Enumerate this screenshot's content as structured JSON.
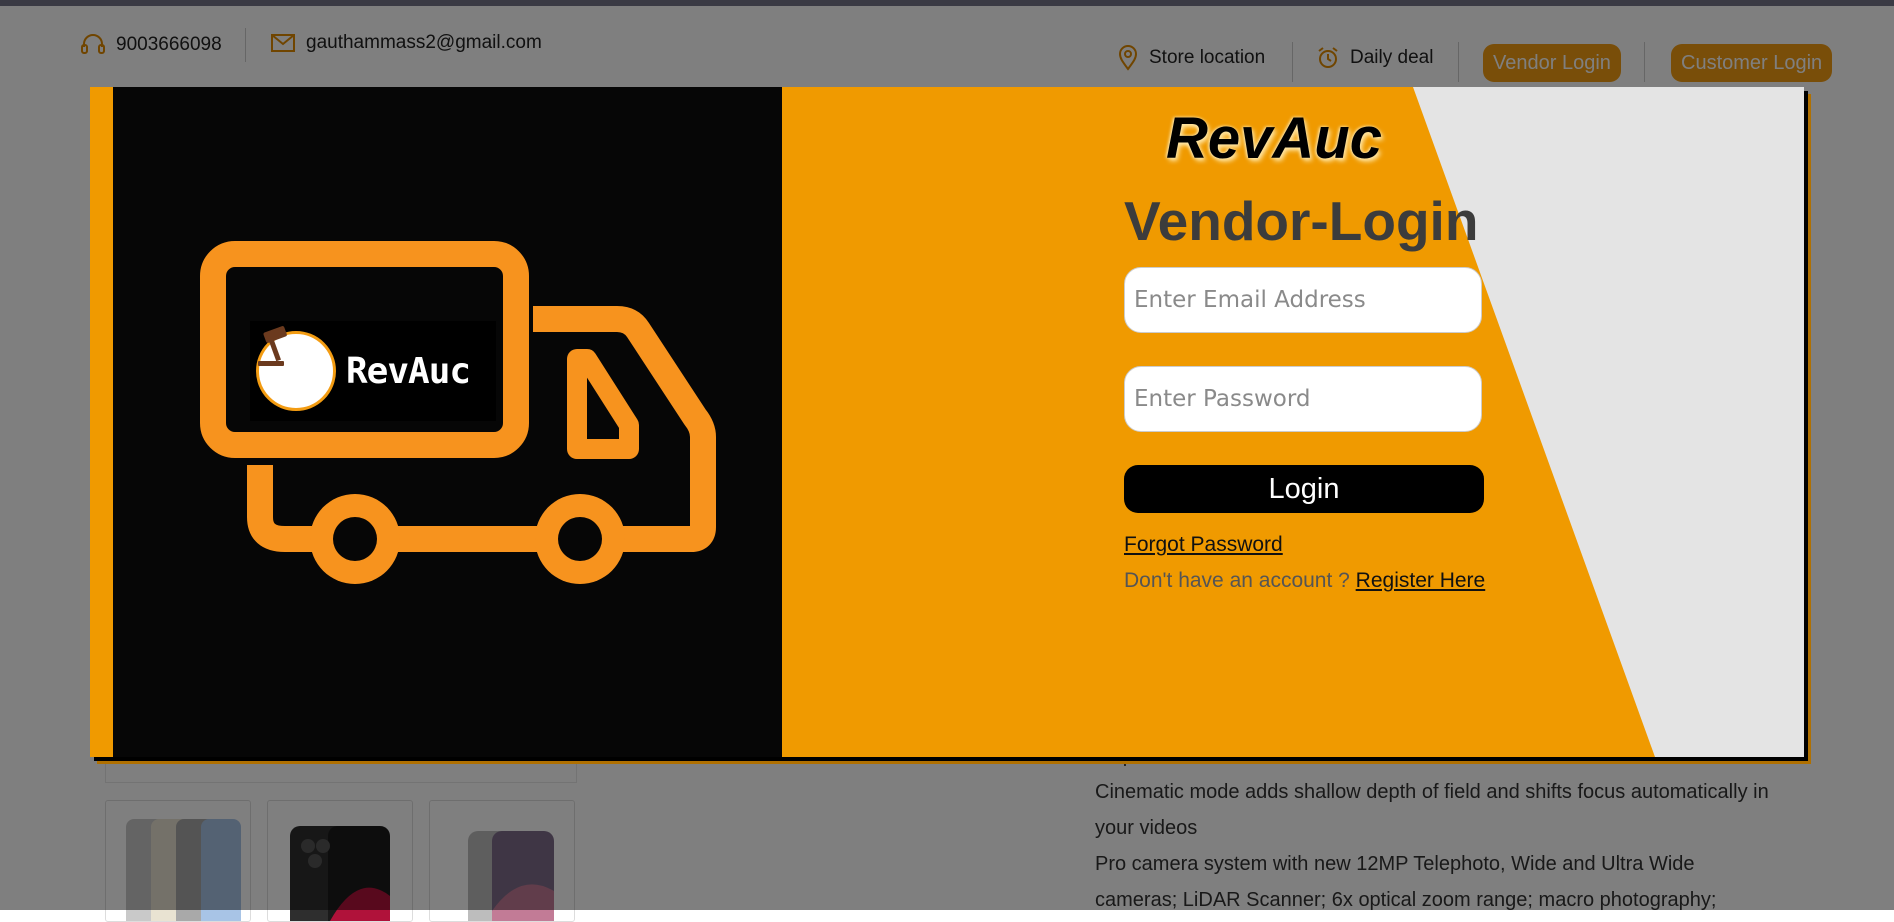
{
  "header": {
    "phone": "9003666098",
    "email": "gauthammass2@gmail.com",
    "store_location": "Store location",
    "daily_deal": "Daily deal",
    "vendor_login": "Vendor Login",
    "customer_login": "Customer Login",
    "icons": {
      "phone": "headset-icon",
      "email": "mail-icon",
      "location": "location-pin-icon",
      "deal": "alarm-clock-icon"
    }
  },
  "product": {
    "description": [
      "responsive feel",
      "Cinematic mode adds shallow depth of field and shifts focus automatically in",
      "your videos",
      "Pro camera system with new 12MP Telephoto, Wide and Ultra Wide",
      "cameras; LiDAR Scanner; 6x optical zoom range; macro photography;"
    ]
  },
  "modal": {
    "illustration_logo_text": "RevAuc",
    "illustration_icons": [
      "truck-icon",
      "gavel-icon"
    ],
    "brand": "RevAuc",
    "title": "Vendor-Login",
    "email_placeholder": "Enter Email Address",
    "password_placeholder": "Enter Password",
    "login_label": "Login",
    "forgot_password": "Forgot Password",
    "no_account_text": "Don't have an account ? ",
    "register_link": "Register Here",
    "colors": {
      "accent": "#f09a00",
      "truck": "#f7931e",
      "panel": "#060606",
      "button": "#000000"
    }
  }
}
